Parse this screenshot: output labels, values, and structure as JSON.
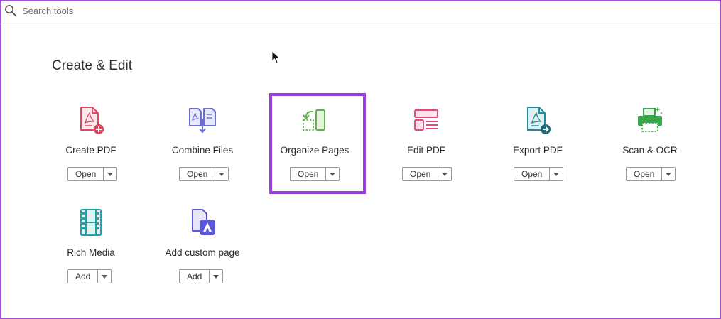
{
  "search": {
    "placeholder": "Search tools",
    "value": ""
  },
  "section": {
    "title": "Create & Edit"
  },
  "tools": [
    {
      "label": "Create PDF",
      "button": "Open",
      "icon": "create-pdf-icon",
      "color": "#e0475e"
    },
    {
      "label": "Combine Files",
      "button": "Open",
      "icon": "combine-files-icon",
      "color": "#6b6fd6"
    },
    {
      "label": "Organize Pages",
      "button": "Open",
      "icon": "organize-pages-icon",
      "color": "#5fb24a"
    },
    {
      "label": "Edit PDF",
      "button": "Open",
      "icon": "edit-pdf-icon",
      "color": "#e8497a"
    },
    {
      "label": "Export PDF",
      "button": "Open",
      "icon": "export-pdf-icon",
      "color": "#1f8a99"
    },
    {
      "label": "Scan & OCR",
      "button": "Open",
      "icon": "scan-ocr-icon",
      "color": "#3aa64a"
    },
    {
      "label": "Rich Media",
      "button": "Add",
      "icon": "rich-media-icon",
      "color": "#20a3a8"
    },
    {
      "label": "Add custom page",
      "button": "Add",
      "icon": "add-custom-page-icon",
      "color": "#5a57d8"
    }
  ],
  "highlight_color": "#9c3fe0"
}
